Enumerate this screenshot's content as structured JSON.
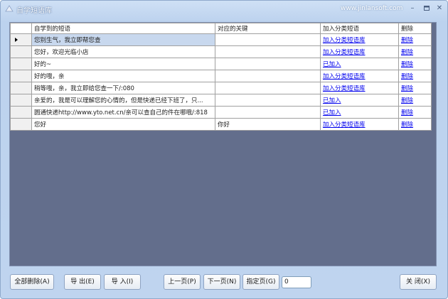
{
  "window": {
    "title": "自学短语库",
    "site": "www.jinlansoft.com",
    "minimize_glyph": "–",
    "maximize_glyph": "▫",
    "close_glyph": "✕"
  },
  "grid": {
    "columns": [
      "自学到的短语",
      "对应的关键",
      "加入分类短语",
      "删除"
    ],
    "rows": [
      {
        "phrase": "您别生气，我立即帮您查",
        "keyword": "",
        "add": "加入分类短语库",
        "del": "删除"
      },
      {
        "phrase": "您好，欢迎光临小店",
        "keyword": "",
        "add": "加入分类短语库",
        "del": "删除"
      },
      {
        "phrase": "好的~",
        "keyword": "",
        "add": "已加入",
        "del": "删除"
      },
      {
        "phrase": "好的哦，亲",
        "keyword": "",
        "add": "加入分类短语库",
        "del": "删除"
      },
      {
        "phrase": "稍等哦，亲，我立即给您查一下/:080",
        "keyword": "",
        "add": "加入分类短语库",
        "del": "删除"
      },
      {
        "phrase": "亲爱的，我是可以理解您的心情的，但是快递已经下班了，只...",
        "keyword": "",
        "add": "已加入",
        "del": "删除"
      },
      {
        "phrase": "圆通快递http://www.yto.net.cn/亲可以查自己的件在哪哦/:818",
        "keyword": "",
        "add": "已加入",
        "del": "删除"
      },
      {
        "phrase": "您好",
        "keyword": "你好",
        "add": "加入分类短语库",
        "del": "删除"
      }
    ]
  },
  "toolbar": {
    "delete_all": "全部删除(A)",
    "export": "导 出(E)",
    "import": "导 入(I)",
    "prev_page": "上一页(P)",
    "next_page": "下一页(N)",
    "goto_page": "指定页(G)",
    "page_value": "0",
    "close": "关 闭(X)"
  },
  "colors": {
    "grid_background": "#636e8c",
    "link": "#0000ee",
    "selected_cell": "#c8d8ee"
  }
}
